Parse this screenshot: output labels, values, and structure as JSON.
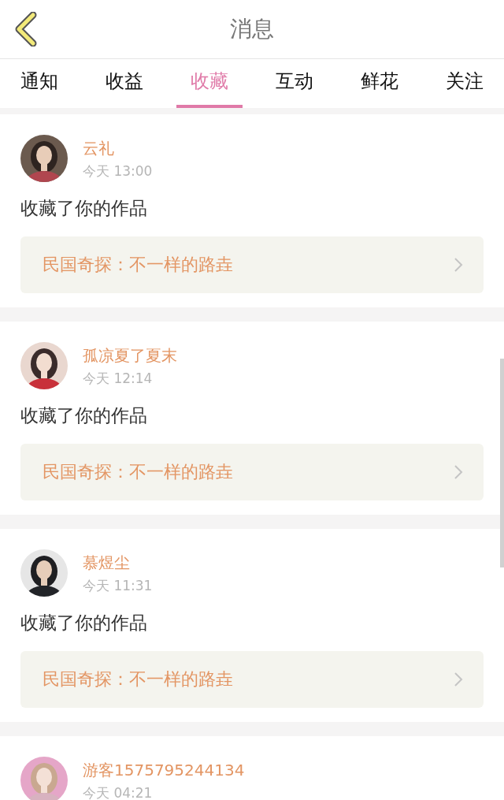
{
  "header": {
    "title": "消息"
  },
  "tabs": [
    {
      "label": "通知",
      "selected": false
    },
    {
      "label": "收益",
      "selected": false
    },
    {
      "label": "收藏",
      "selected": true
    },
    {
      "label": "互动",
      "selected": false
    },
    {
      "label": "鲜花",
      "selected": false
    },
    {
      "label": "关注",
      "selected": false
    }
  ],
  "messages": [
    {
      "user": "云礼",
      "time": "今天 13:00",
      "action": "收藏了你的作品",
      "work": "民国奇探：不一样的路垚"
    },
    {
      "user": "孤凉夏了夏末",
      "time": "今天 12:14",
      "action": "收藏了你的作品",
      "work": "民国奇探：不一样的路垚"
    },
    {
      "user": "慕煜尘",
      "time": "今天 11:31",
      "action": "收藏了你的作品",
      "work": "民国奇探：不一样的路垚"
    },
    {
      "user": "游客1575795244134",
      "time": "今天 04:21"
    }
  ]
}
